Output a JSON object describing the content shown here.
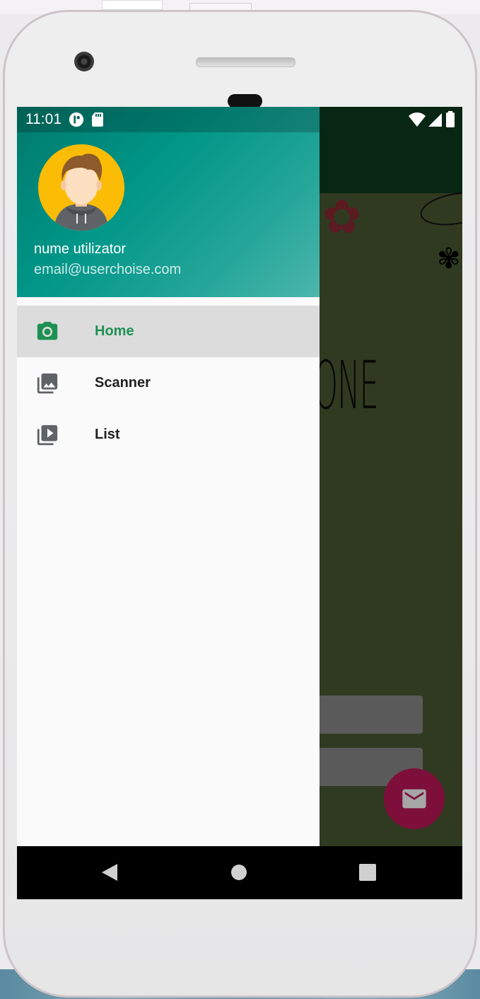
{
  "status_bar": {
    "time": "11:01"
  },
  "drawer": {
    "header": {
      "user_name": "nume utilizator",
      "user_email": "email@userchoise.com"
    },
    "menu": [
      {
        "label": "Home",
        "icon": "camera-icon",
        "active": true
      },
      {
        "label": "Scanner",
        "icon": "photo-library-icon",
        "active": false
      },
      {
        "label": "List",
        "icon": "video-library-icon",
        "active": false
      }
    ]
  },
  "background_app": {
    "visible_text": "ONE"
  },
  "colors": {
    "header_gradient_start": "#00796b",
    "header_gradient_end": "#4db6ac",
    "active_item": "#1e9152",
    "fab": "#c2185b"
  }
}
